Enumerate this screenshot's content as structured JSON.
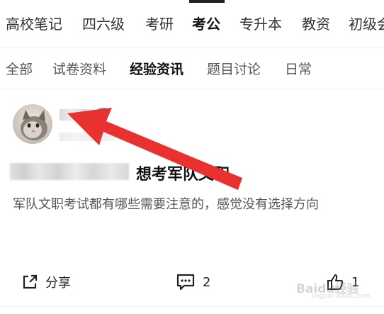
{
  "top_tabs": [
    "高校笔记",
    "四六级",
    "考研",
    "考公",
    "专升本",
    "教资",
    "初级会"
  ],
  "top_active": "考公",
  "sub_tabs": [
    "全部",
    "试卷资料",
    "经验资讯",
    "题目讨论",
    "日常"
  ],
  "sub_active": "经验资讯",
  "post": {
    "title": "想考军队文职",
    "body": "军队文职考试都有哪些需要注意的，感觉没有选择方向",
    "share_label": "分享",
    "comment_count": "2",
    "like_count": "1"
  },
  "watermark": {
    "text": "Baidu经验",
    "sub": "jingyan.baidu.com"
  },
  "colors": {
    "annotation_arrow": "#e8322f",
    "verified_badge": "#3db3e8"
  },
  "icons": [
    "share-icon",
    "comment-icon",
    "like-icon",
    "verified-icon"
  ]
}
